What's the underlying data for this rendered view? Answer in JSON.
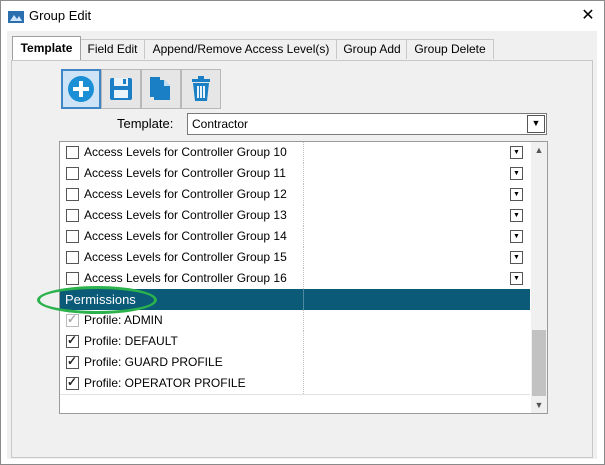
{
  "window": {
    "title": "Group Edit",
    "close_glyph": "✕"
  },
  "tabs": [
    {
      "label": "Template",
      "active": true
    },
    {
      "label": "Field Edit",
      "active": false
    },
    {
      "label": "Append/Remove Access Level(s)",
      "active": false
    },
    {
      "label": "Group Add",
      "active": false
    },
    {
      "label": "Group Delete",
      "active": false
    }
  ],
  "toolbar": {
    "buttons": [
      {
        "icon": "add-icon"
      },
      {
        "icon": "save-icon"
      },
      {
        "icon": "copy-icon"
      },
      {
        "icon": "trash-icon"
      }
    ]
  },
  "template": {
    "label": "Template:",
    "value": "Contractor"
  },
  "grid": {
    "access_rows": [
      {
        "label": "Access Levels for Controller Group 10",
        "checked": false
      },
      {
        "label": "Access Levels for Controller Group 11",
        "checked": false
      },
      {
        "label": "Access Levels for Controller Group 12",
        "checked": false
      },
      {
        "label": "Access Levels for Controller Group 13",
        "checked": false
      },
      {
        "label": "Access Levels for Controller Group 14",
        "checked": false
      },
      {
        "label": "Access Levels for Controller Group 15",
        "checked": false
      },
      {
        "label": "Access Levels for Controller Group 16",
        "checked": false
      }
    ],
    "section_header": "Permissions",
    "profile_rows": [
      {
        "label": "Profile:  ADMIN",
        "checked": true,
        "disabled": true
      },
      {
        "label": "Profile:  DEFAULT",
        "checked": true,
        "disabled": false
      },
      {
        "label": "Profile:  GUARD PROFILE",
        "checked": true,
        "disabled": false
      },
      {
        "label": "Profile:  OPERATOR PROFILE",
        "checked": true,
        "disabled": false
      }
    ],
    "scroll_up_glyph": "▲",
    "scroll_down_glyph": "▼",
    "dropdown_glyph": "▼"
  },
  "colors": {
    "section_header_bg": "#0a5a78",
    "highlight_ellipse": "#2bb24c",
    "selected_button_border": "#3f86c7"
  }
}
